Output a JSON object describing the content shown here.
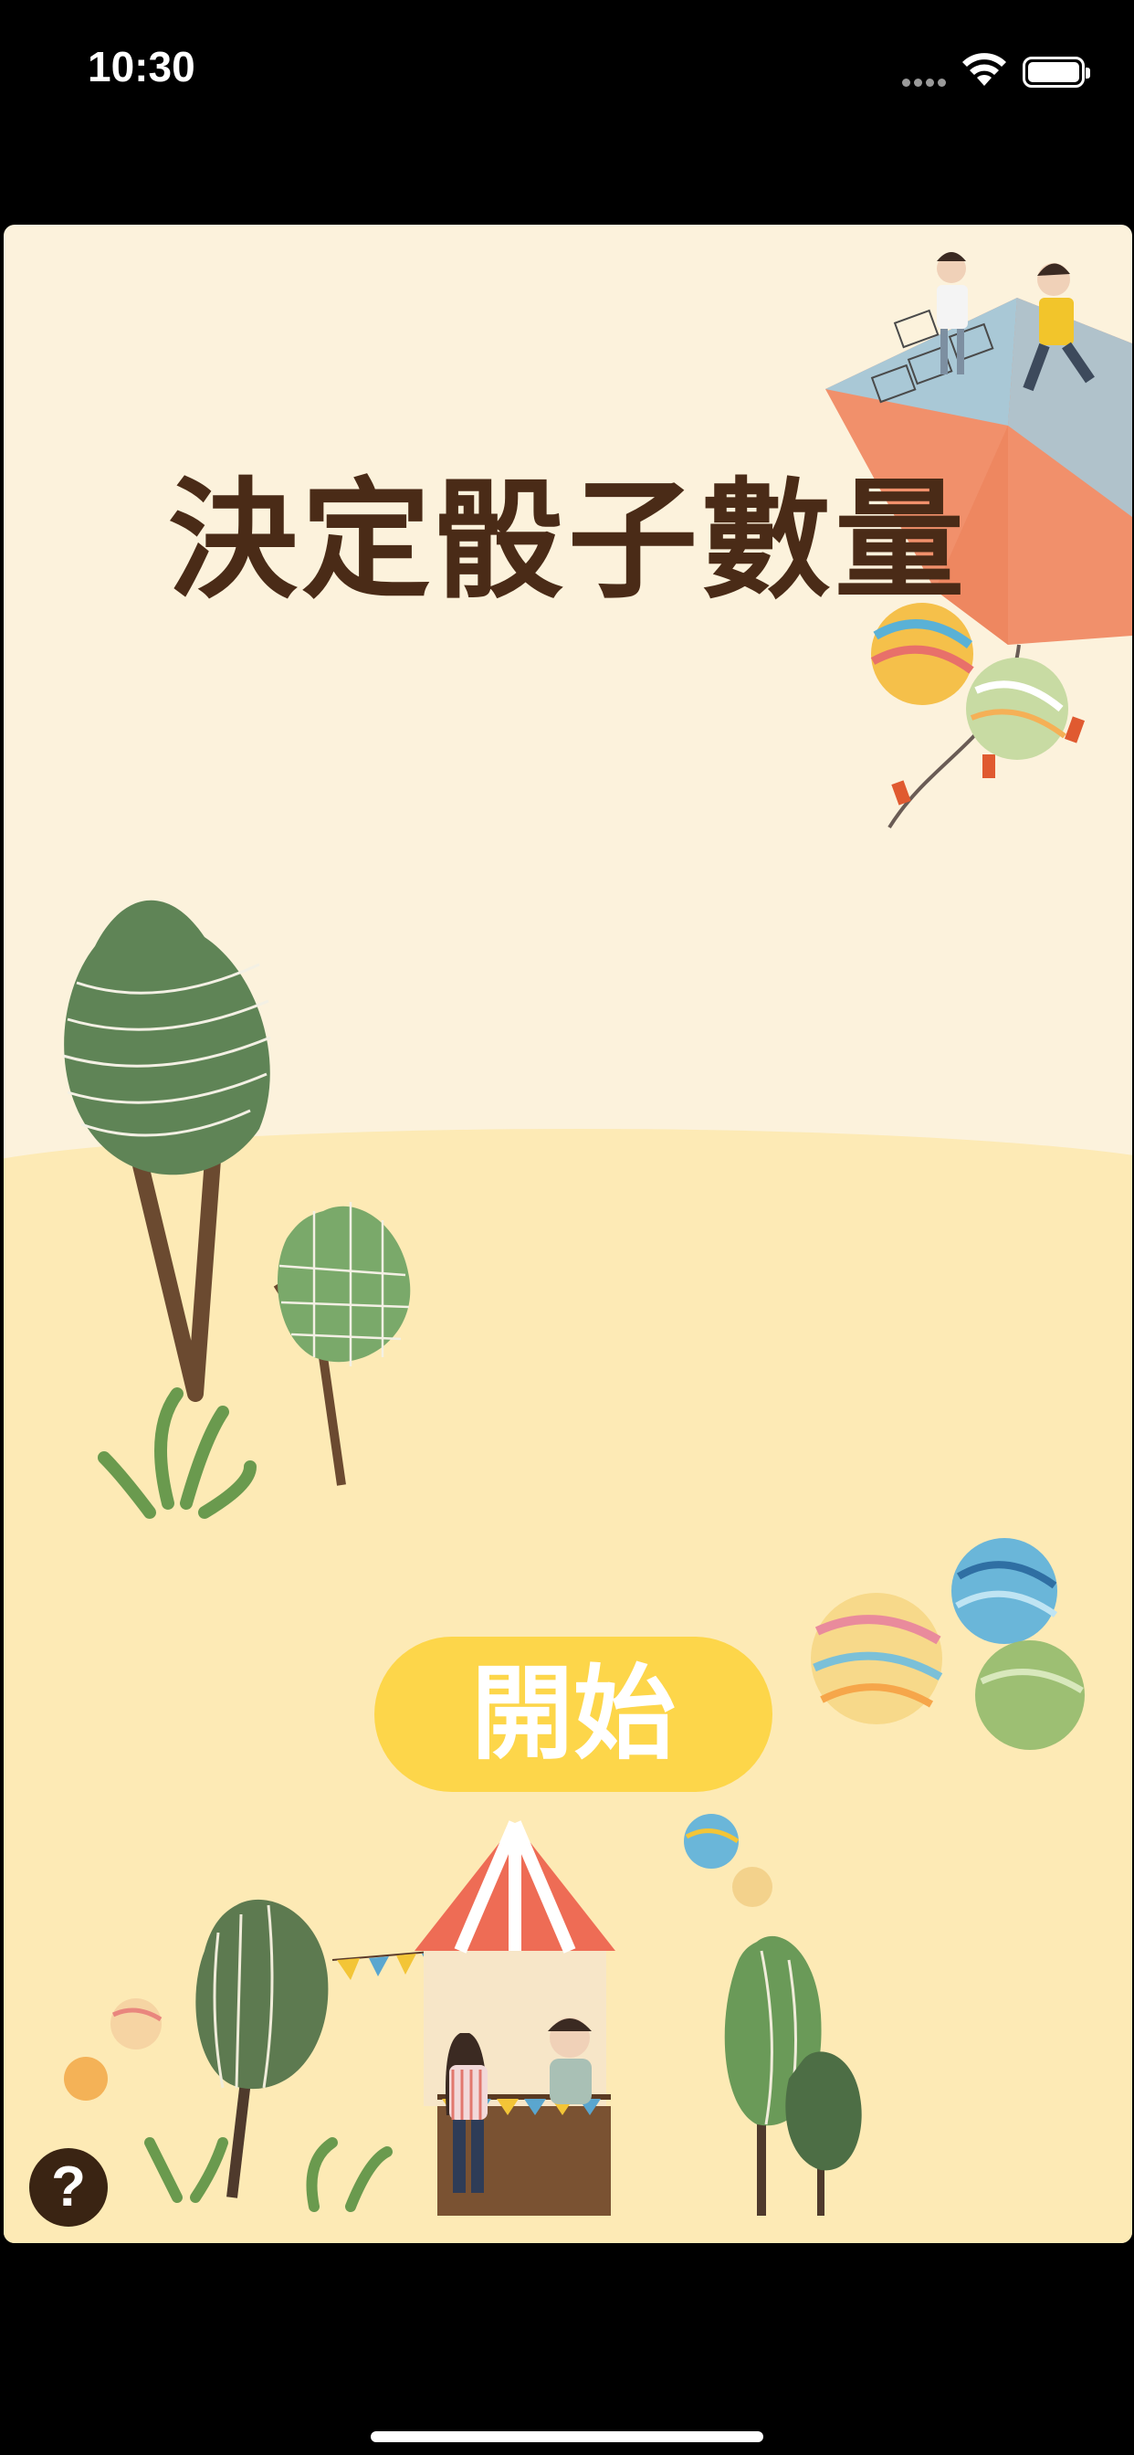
{
  "status_bar": {
    "time": "10:30",
    "icons": [
      "cellular-signal-icon",
      "wifi-icon",
      "battery-icon"
    ]
  },
  "screen": {
    "title": "決定骰子數量",
    "start_label": "開始",
    "help_label": "?"
  },
  "colors": {
    "sky": "#fcf2dc",
    "ground": "#fdeab5",
    "title": "#4a2b17",
    "button": "#fdd64a",
    "help": "#3a2413"
  }
}
